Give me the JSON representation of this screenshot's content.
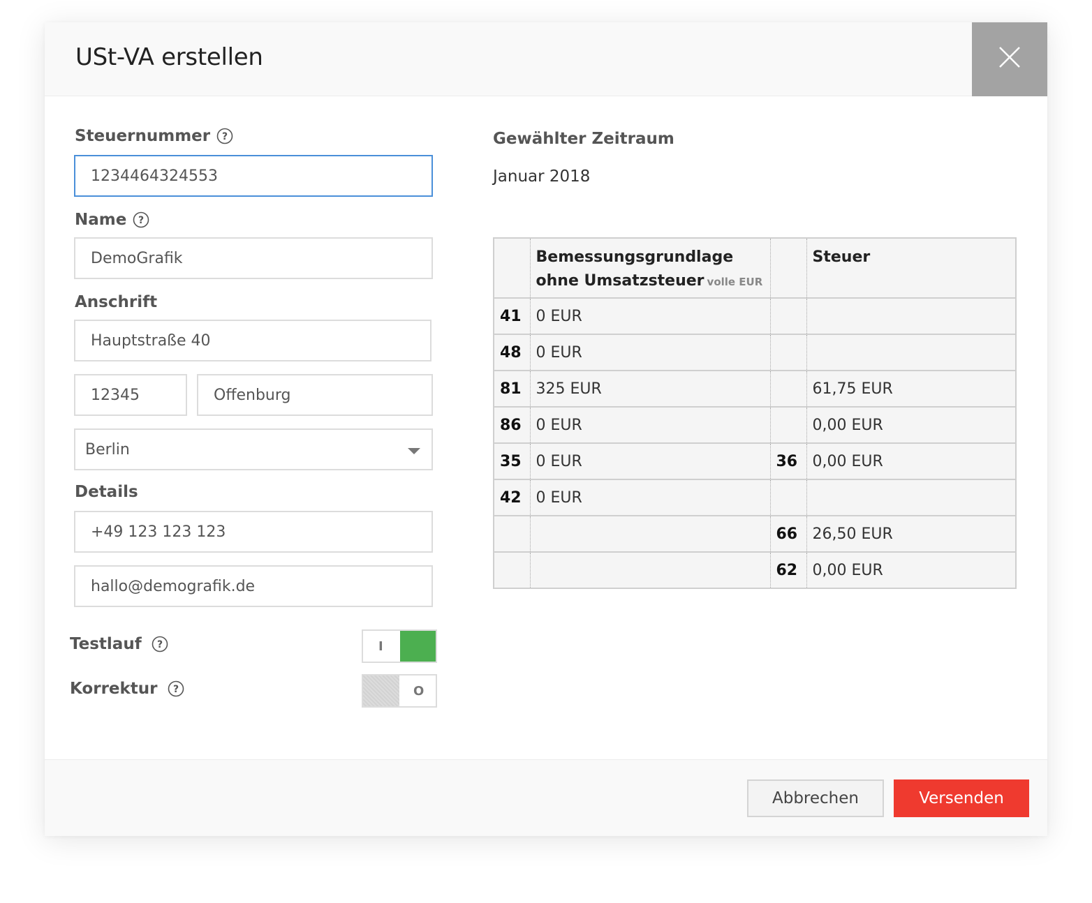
{
  "dialog": {
    "title": "USt-VA erstellen"
  },
  "form": {
    "tax_number": {
      "label": "Steuernummer",
      "value": "1234464324553"
    },
    "name": {
      "label": "Name",
      "value": "DemoGrafik"
    },
    "address": {
      "label": "Anschrift",
      "street": "Hauptstraße 40",
      "zip": "12345",
      "city": "Offenburg",
      "state": "Berlin"
    },
    "details": {
      "label": "Details",
      "phone": "+49 123 123 123",
      "email": "hallo@demografik.de"
    },
    "testrun": {
      "label": "Testlauf",
      "state_text": "I",
      "on": true
    },
    "correction": {
      "label": "Korrektur",
      "state_text": "O",
      "on": false
    }
  },
  "period": {
    "heading": "Gewählter Zeitraum",
    "value": "Januar 2018"
  },
  "tax_table": {
    "header": {
      "base_line1": "Bemessungsgrundlage",
      "base_line2": "ohne Umsatzsteuer",
      "base_note": "volle EUR",
      "tax": "Steuer"
    },
    "rows": [
      {
        "code": "41",
        "base": "0 EUR",
        "tax_code": "",
        "tax": ""
      },
      {
        "code": "48",
        "base": "0 EUR",
        "tax_code": "",
        "tax": ""
      },
      {
        "code": "81",
        "base": "325 EUR",
        "tax_code": "",
        "tax": "61,75 EUR"
      },
      {
        "code": "86",
        "base": "0 EUR",
        "tax_code": "",
        "tax": "0,00 EUR"
      },
      {
        "code": "35",
        "base": "0 EUR",
        "tax_code": "36",
        "tax": "0,00 EUR"
      },
      {
        "code": "42",
        "base": "0 EUR",
        "tax_code": "",
        "tax": ""
      },
      {
        "code": "",
        "base": "",
        "tax_code": "66",
        "tax": "26,50 EUR"
      },
      {
        "code": "",
        "base": "",
        "tax_code": "62",
        "tax": "0,00 EUR"
      }
    ]
  },
  "footer": {
    "cancel_label": "Abbrechen",
    "send_label": "Versenden"
  },
  "colors": {
    "accent": "#ef3a2f",
    "toggle_on": "#4caf50",
    "focus": "#4a8fd9",
    "close_bg": "#a3a3a3"
  },
  "icons": {
    "close": "close-icon",
    "help": "help-icon",
    "dropdown": "chevron-down-icon"
  }
}
